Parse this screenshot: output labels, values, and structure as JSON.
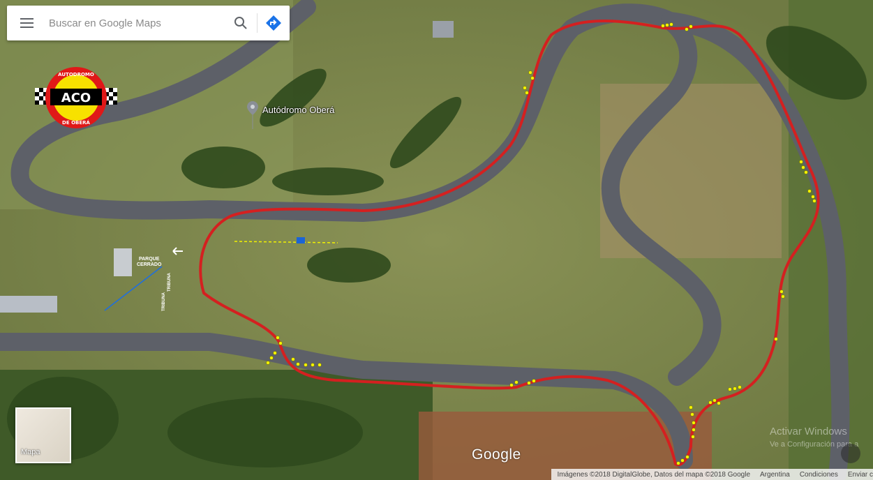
{
  "search": {
    "placeholder": "Buscar en Google Maps"
  },
  "icons": {
    "menu": "menu-icon",
    "search": "search-icon",
    "directions": "directions-icon",
    "place_pin": "place-pin-icon"
  },
  "map": {
    "view": "satellite",
    "place_label": "Autódromo Oberá",
    "circuit_color": "#d42020",
    "marker_color": "#f2f200"
  },
  "annotations": {
    "parque_line1": "PARQUE",
    "parque_line2": "CERRADO",
    "tribuna1": "TRIBUNA",
    "tribuna2": "TRIBUNA"
  },
  "logo": {
    "top_text": "AUTODROMO",
    "center_text": "ACO",
    "bottom_text": "DE OBERÁ"
  },
  "layer_toggle": {
    "label": "Mapa"
  },
  "google_logo": "Google",
  "footer": {
    "imagery": "Imágenes ©2018 DigitalGlobe, Datos del mapa ©2018 Google",
    "country": "Argentina",
    "terms": "Condiciones",
    "feedback": "Enviar c"
  },
  "watermark": {
    "line1": "Activar Windows",
    "line2": "Ve a Configuración para a"
  }
}
